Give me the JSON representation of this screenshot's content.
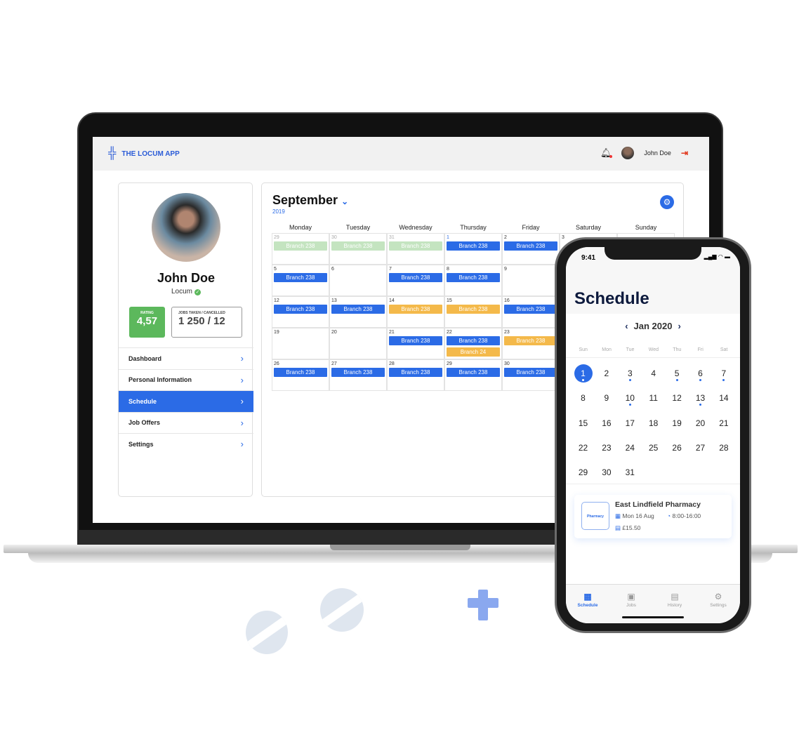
{
  "desktop": {
    "brand": "THE LOCUM APP",
    "user_name": "John Doe",
    "profile": {
      "name": "John Doe",
      "role": "Locum",
      "rating_label": "RATING",
      "rating": "4,57",
      "jobs_label": "JOBS TAKEN / CANCELLED",
      "jobs": "1 250 / 12"
    },
    "menu": [
      {
        "label": "Dashboard"
      },
      {
        "label": "Personal Information"
      },
      {
        "label": "Schedule",
        "active": true
      },
      {
        "label": "Job Offers"
      },
      {
        "label": "Settings"
      }
    ],
    "calendar": {
      "month": "September",
      "year": "2019",
      "weekdays": [
        "Monday",
        "Tuesday",
        "Wednesday",
        "Thursday",
        "Friday",
        "Saturday",
        "Sunday"
      ],
      "weeks": [
        [
          {
            "d": "29",
            "muted": true,
            "ev": [
              {
                "t": "Branch 238",
                "c": "green"
              }
            ]
          },
          {
            "d": "30",
            "muted": true,
            "ev": [
              {
                "t": "Branch 238",
                "c": "green"
              }
            ]
          },
          {
            "d": "31",
            "muted": true,
            "ev": [
              {
                "t": "Branch 238",
                "c": "green"
              }
            ]
          },
          {
            "d": "1",
            "today": true,
            "ev": [
              {
                "t": "Branch 238",
                "c": "blue"
              }
            ]
          },
          {
            "d": "2",
            "ev": [
              {
                "t": "Branch 238",
                "c": "blue"
              }
            ]
          },
          {
            "d": "3",
            "ev": []
          },
          {
            "d": "",
            "ev": []
          }
        ],
        [
          {
            "d": "5",
            "ev": [
              {
                "t": "Branch 238",
                "c": "blue"
              }
            ]
          },
          {
            "d": "6",
            "ev": []
          },
          {
            "d": "7",
            "ev": [
              {
                "t": "Branch 238",
                "c": "blue"
              }
            ]
          },
          {
            "d": "8",
            "ev": [
              {
                "t": "Branch 238",
                "c": "blue"
              }
            ]
          },
          {
            "d": "9",
            "ev": []
          },
          {
            "d": "",
            "ev": []
          },
          {
            "d": "",
            "ev": []
          }
        ],
        [
          {
            "d": "12",
            "ev": [
              {
                "t": "Branch 238",
                "c": "blue"
              }
            ]
          },
          {
            "d": "13",
            "ev": [
              {
                "t": "Branch 238",
                "c": "blue"
              }
            ]
          },
          {
            "d": "14",
            "ev": [
              {
                "t": "Branch 238",
                "c": "orange"
              }
            ]
          },
          {
            "d": "15",
            "ev": [
              {
                "t": "Branch 238",
                "c": "orange"
              }
            ]
          },
          {
            "d": "16",
            "ev": [
              {
                "t": "Branch 238",
                "c": "blue"
              }
            ]
          },
          {
            "d": "",
            "ev": []
          },
          {
            "d": "",
            "ev": []
          }
        ],
        [
          {
            "d": "19",
            "ev": []
          },
          {
            "d": "20",
            "ev": []
          },
          {
            "d": "21",
            "ev": [
              {
                "t": "Branch 238",
                "c": "blue"
              }
            ]
          },
          {
            "d": "22",
            "ev": [
              {
                "t": "Branch 238",
                "c": "blue"
              },
              {
                "t": "Branch 24",
                "c": "orange"
              }
            ]
          },
          {
            "d": "23",
            "ev": [
              {
                "t": "Branch 238",
                "c": "orange"
              }
            ]
          },
          {
            "d": "",
            "ev": []
          },
          {
            "d": "",
            "ev": []
          }
        ],
        [
          {
            "d": "26",
            "ev": [
              {
                "t": "Branch 238",
                "c": "blue"
              }
            ]
          },
          {
            "d": "27",
            "ev": [
              {
                "t": "Branch 238",
                "c": "blue"
              }
            ]
          },
          {
            "d": "28",
            "ev": [
              {
                "t": "Branch 238",
                "c": "blue"
              }
            ]
          },
          {
            "d": "29",
            "ev": [
              {
                "t": "Branch 238",
                "c": "blue"
              }
            ]
          },
          {
            "d": "30",
            "ev": [
              {
                "t": "Branch 238",
                "c": "blue"
              }
            ]
          },
          {
            "d": "",
            "ev": []
          },
          {
            "d": "",
            "ev": []
          }
        ]
      ]
    }
  },
  "mobile": {
    "time": "9:41",
    "title": "Schedule",
    "month": "Jan 2020",
    "weekdays": [
      "Sun",
      "Mon",
      "Tue",
      "Wed",
      "Thu",
      "Fri",
      "Sat"
    ],
    "days": 31,
    "first_weekday": 0,
    "selected": 1,
    "event_days": [
      1,
      3,
      5,
      6,
      7,
      10,
      13
    ],
    "card": {
      "title": "East Lindfield Pharmacy",
      "logo": "Pharmacy",
      "date": "Mon 16 Aug",
      "time": "8:00-16:00",
      "rate": "£15.50"
    },
    "tabs": [
      {
        "label": "Schedule",
        "icon": "calendar-icon",
        "active": true
      },
      {
        "label": "Jobs",
        "icon": "briefcase-icon"
      },
      {
        "label": "History",
        "icon": "scroll-icon"
      },
      {
        "label": "Settings",
        "icon": "gear-icon"
      }
    ]
  },
  "colors": {
    "accent": "#2b6be6",
    "green": "#5cb85c",
    "orange": "#f4b94a",
    "event_past": "#c4e4c0"
  }
}
